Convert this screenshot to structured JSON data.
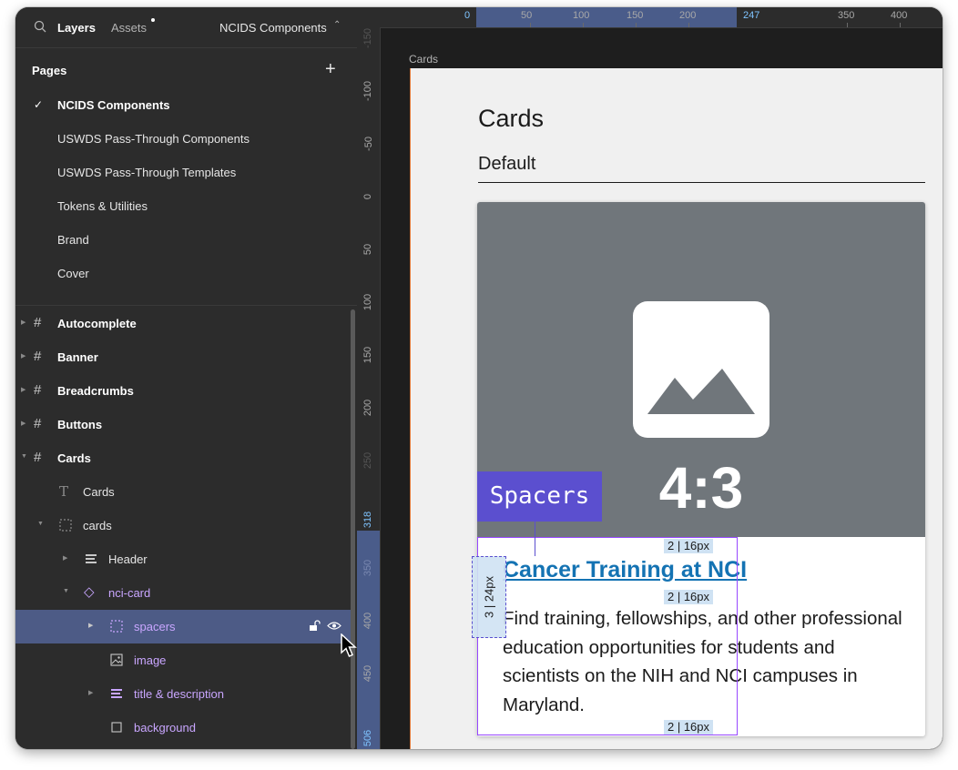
{
  "sidebar": {
    "tabs": {
      "layers": "Layers",
      "assets": "Assets"
    },
    "page_selector": "NCIDS Components",
    "pages_heading": "Pages",
    "pages": [
      {
        "label": "NCIDS Components",
        "current": true
      },
      {
        "label": "USWDS Pass-Through Components"
      },
      {
        "label": "USWDS Pass-Through Templates"
      },
      {
        "label": "Tokens & Utilities"
      },
      {
        "label": "Brand"
      },
      {
        "label": "Cover"
      }
    ],
    "layers": [
      {
        "label": "Autocomplete"
      },
      {
        "label": "Banner"
      },
      {
        "label": "Breadcrumbs"
      },
      {
        "label": "Buttons"
      },
      {
        "label": "Cards"
      },
      {
        "label": "Cards"
      },
      {
        "label": "cards"
      },
      {
        "label": "Header"
      },
      {
        "label": "nci-card"
      },
      {
        "label": "spacers"
      },
      {
        "label": "image"
      },
      {
        "label": "title & description"
      },
      {
        "label": "background"
      }
    ]
  },
  "ruler": {
    "horizontal": [
      "0",
      "50",
      "100",
      "150",
      "200",
      "247",
      "350",
      "400"
    ],
    "vertical": [
      "-150",
      "-100",
      "-50",
      "0",
      "50",
      "100",
      "150",
      "200",
      "250",
      "318",
      "350",
      "400",
      "450",
      "506"
    ]
  },
  "canvas": {
    "frame_label": "Cards",
    "title": "Cards",
    "subtitle": "Default",
    "card": {
      "ratio": "4:3",
      "title": "Cancer Training at NCI",
      "description": "Find training, fellowships, and other professional education opportunities for students and scientists on the NIH and NCI campuses in Maryland."
    },
    "spacer_tag": "Spacers",
    "spacer_labels": {
      "top": "2 | 16px",
      "middle": "2 | 16px",
      "bottom": "2 | 16px",
      "left": "3 | 24px"
    }
  },
  "colors": {
    "accent": "#5b4fcf",
    "link": "#1473b3",
    "selection": "#4d5b86",
    "component_purple": "#c9a6ff"
  }
}
